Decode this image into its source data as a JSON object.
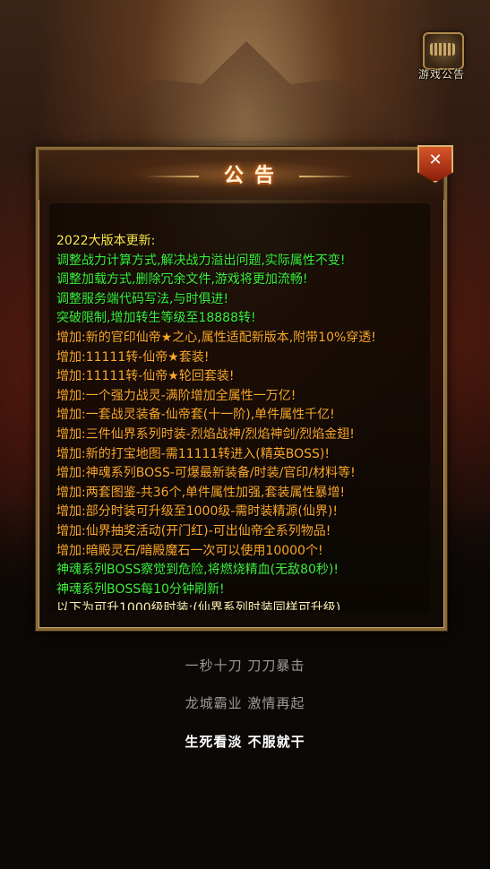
{
  "notice_icon": {
    "caption": "游戏公告"
  },
  "panel": {
    "title": "公告",
    "close_label": "✕",
    "lines": [
      {
        "text": "2022大版本更新:",
        "color": "#ffe84a"
      },
      {
        "text": "调整战力计算方式,解决战力溢出问题,实际属性不变!",
        "color": "#3cf03c"
      },
      {
        "text": "调整加载方式,删除冗余文件,游戏将更加流畅!",
        "color": "#3cf03c"
      },
      {
        "text": "调整服务端代码写法,与时俱进!",
        "color": "#3cf03c"
      },
      {
        "text": "突破限制,增加转生等级至18888转!",
        "color": "#3cf03c"
      },
      {
        "text": "增加:新的官印仙帝★之心,属性适配新版本,附带10%穿透!",
        "color": "#ffa82a"
      },
      {
        "text": "增加:11111转-仙帝★套装!",
        "color": "#ffa82a"
      },
      {
        "text": "增加:11111转-仙帝★轮回套装!",
        "color": "#ffa82a"
      },
      {
        "text": "增加:一个强力战灵-满阶增加全属性一万亿!",
        "color": "#ffa82a"
      },
      {
        "text": "增加:一套战灵装备-仙帝套(十一阶),单件属性千亿!",
        "color": "#ffa82a"
      },
      {
        "text": "增加:三件仙界系列时装-烈焰战神/烈焰神剑/烈焰金翅!",
        "color": "#ffa82a"
      },
      {
        "text": "增加:新的打宝地图-需11111转进入(精英BOSS)!",
        "color": "#ffa82a"
      },
      {
        "text": "增加:神魂系列BOSS-可爆最新装备/时装/官印/材料等!",
        "color": "#ffa82a"
      },
      {
        "text": "增加:两套图鉴-共36个,单件属性加强,套装属性暴增!",
        "color": "#ffa82a"
      },
      {
        "text": "增加:部分时装可升级至1000级-需时装精源(仙界)!",
        "color": "#ffa82a"
      },
      {
        "text": "增加:仙界抽奖活动(开门红)-可出仙帝全系列物品!",
        "color": "#ffa82a"
      },
      {
        "text": "增加:暗殿灵石/暗殿魔石一次可以使用10000个!",
        "color": "#ffa82a"
      },
      {
        "text": "神魂系列BOSS察觉到危险,将燃烧精血(无敌80秒)!",
        "color": "#3cf03c"
      },
      {
        "text": "神魂系列BOSS每10分钟刷新!",
        "color": "#3cf03c"
      },
      {
        "text": "以下为可升1000级时装:(仙界系列时装同样可升级)",
        "color": "#fff0b0"
      }
    ]
  },
  "slogans": [
    "一秒十刀 刀刀暴击",
    "龙城霸业 激情再起",
    "生死看淡 不服就干"
  ]
}
